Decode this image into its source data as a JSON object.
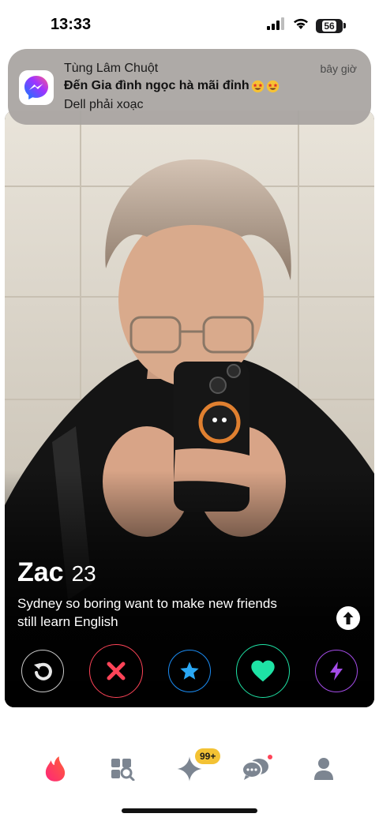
{
  "status_bar": {
    "time": "13:33",
    "battery": "56",
    "battery_level": 0.56,
    "icons": [
      "signal-icon",
      "wifi-icon",
      "battery-icon"
    ]
  },
  "notification": {
    "app_icon": "messenger-icon",
    "sender": "Tùng Lâm Chuột",
    "time": "bây giờ",
    "title": "Đến Gia đình ngọc hà mãi đỉnh",
    "title_emojis": [
      "star-struck-emoji",
      "star-struck-emoji"
    ],
    "body": "Dell phải xoạc"
  },
  "profile": {
    "name": "Zac",
    "age": "23",
    "bio": [
      "Sydney so boring want to make new friends",
      "still learn English"
    ],
    "photo": "profile-photo"
  },
  "actions": [
    {
      "name": "rewind",
      "icon": "rewind-icon",
      "color": "#e8e8e8"
    },
    {
      "name": "nope",
      "icon": "close-icon",
      "color": "#ff4458"
    },
    {
      "name": "super-like",
      "icon": "star-icon",
      "color": "#1b8cf3"
    },
    {
      "name": "like",
      "icon": "heart-icon",
      "color": "#1ee3a5"
    },
    {
      "name": "boost",
      "icon": "lightning-icon",
      "color": "#a44ce8"
    }
  ],
  "bottom_nav": {
    "items": [
      {
        "name": "discover",
        "icon": "flame-icon",
        "active": true
      },
      {
        "name": "explore",
        "icon": "explore-icon"
      },
      {
        "name": "likes",
        "icon": "sparkle-icon"
      },
      {
        "name": "messages",
        "icon": "chat-icon"
      },
      {
        "name": "profile",
        "icon": "person-icon"
      }
    ],
    "likes_badge": "99+",
    "accent": "#ff4458",
    "inactive": "#7c8591"
  }
}
